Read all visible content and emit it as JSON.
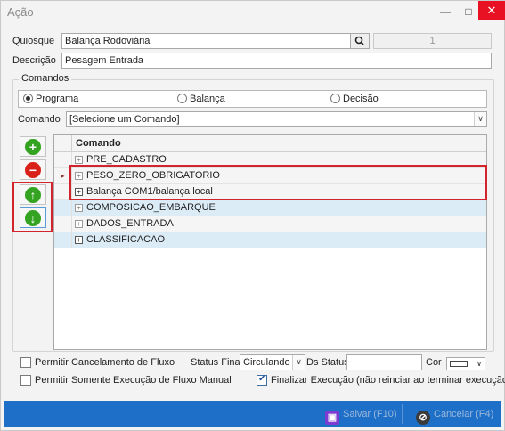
{
  "window": {
    "title": "Ação",
    "minimize_glyph": "—",
    "maximize_glyph": "□",
    "close_glyph": "✕"
  },
  "form": {
    "quiosque_label": "Quiosque",
    "quiosque_value": "Balança Rodoviária",
    "quiosque_id": "1",
    "descricao_label": "Descrição",
    "descricao_value": "Pesagem Entrada"
  },
  "comandos": {
    "group_title": "Comandos",
    "radio_programa": "Programa",
    "radio_balanca": "Balança",
    "radio_decisao": "Decisão",
    "selected": "Programa",
    "comando_label": "Comando",
    "comando_value": "[Selecione um Comando]"
  },
  "grid": {
    "column": "Comando",
    "rows": [
      {
        "expander": "+",
        "text": "PRE_CADASTRO"
      },
      {
        "expander": "+",
        "text": "PESO_ZERO_OBRIGATORIO"
      },
      {
        "expander": "+",
        "text": "Balança COM1/balança local"
      },
      {
        "expander": "+",
        "text": "COMPOSICAO_EMBARQUE"
      },
      {
        "expander": "+",
        "text": "DADOS_ENTRADA"
      },
      {
        "expander": "+",
        "text": "CLASSIFICACAO"
      }
    ],
    "current_row_marker": "▸"
  },
  "side_buttons": {
    "add": "+",
    "remove": "−",
    "up": "↑",
    "down": "↓"
  },
  "options": {
    "permitir_cancelamento": "Permitir Cancelamento de Fluxo",
    "status_final_label": "Status Final",
    "status_final_value": "Circulando",
    "ds_status_label": "Ds Status",
    "ds_status_value": "",
    "cor_label": "Cor",
    "permitir_manual": "Permitir Somente Execução de Fluxo Manual",
    "finalizar_execucao": "Finalizar Execução (não reinciar ao terminar execução)",
    "permitir_cancelamento_checked": false,
    "permitir_manual_checked": false,
    "finalizar_execucao_checked": true
  },
  "footer": {
    "save_label": "Salvar (F10)",
    "cancel_label": "Cancelar (F4)",
    "bar_color": "#1e6fc7"
  },
  "colors": {
    "highlight_border": "#d3242c",
    "green_button": "#34a321",
    "red_button": "#d9211a",
    "row_blue": "#dcecf7"
  },
  "icons": {
    "search": "🔍",
    "dropdown": "∨",
    "save": "▣",
    "cancel": "⊘"
  }
}
